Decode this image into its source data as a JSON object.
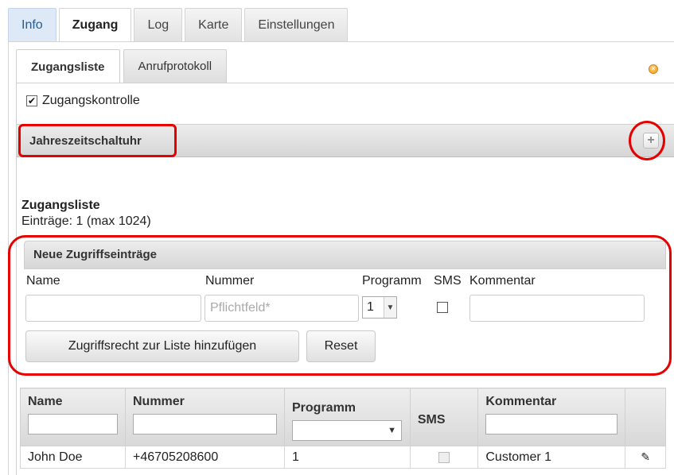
{
  "top_tabs": [
    "Info",
    "Zugang",
    "Log",
    "Karte",
    "Einstellungen"
  ],
  "sub_tabs": [
    "Zugangsliste",
    "Anrufprotokoll"
  ],
  "access_control": {
    "label": "Zugangskontrolle",
    "checked": true
  },
  "season_timer": {
    "title": "Jahreszeitschaltuhr",
    "add_symbol": "+"
  },
  "access_list": {
    "heading": "Zugangsliste",
    "entries_text": "Einträge: 1 (max 1024)"
  },
  "new_entry": {
    "title": "Neue Zugriffseinträge",
    "labels": {
      "name": "Name",
      "number": "Nummer",
      "program": "Programm",
      "sms": "SMS",
      "comment": "Kommentar"
    },
    "number_placeholder": "Pflichtfeld*",
    "program_value": "1",
    "add_button": "Zugriffsrecht zur Liste hinzufügen",
    "reset_button": "Reset"
  },
  "table": {
    "headers": [
      "Name",
      "Nummer",
      "Programm",
      "SMS",
      "Kommentar"
    ],
    "rows": [
      {
        "name": "John Doe",
        "number": "+46705208600",
        "program": "1",
        "sms": false,
        "comment": "Customer 1"
      }
    ]
  },
  "icons": {
    "close": "close-dot-icon",
    "add": "plus-icon",
    "edit": "pencil-icon"
  },
  "colors": {
    "highlight": "#e60000",
    "info_tab": "#dde9f7"
  }
}
